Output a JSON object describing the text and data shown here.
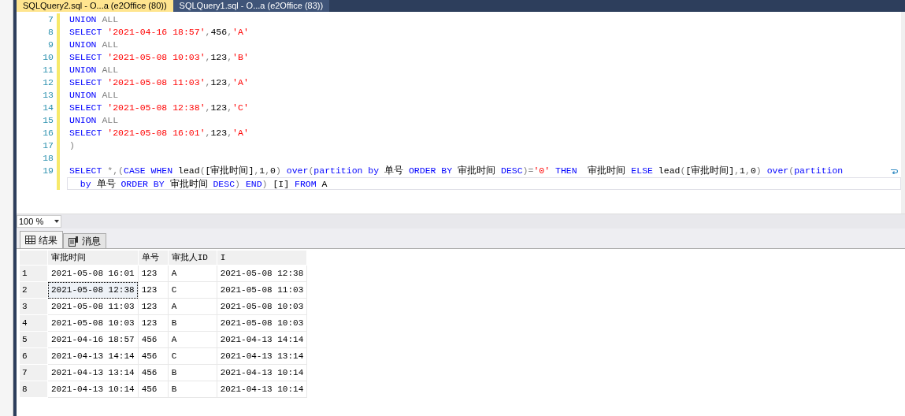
{
  "document_tabs": [
    {
      "title": "SQLQuery2.sql - O...a (e2Office (80))",
      "selected": true
    },
    {
      "title": "SQLQuery1.sql - O...a (e2Office (83))",
      "selected": false
    }
  ],
  "editor": {
    "lines": [
      {
        "number": "7",
        "tokens": [
          {
            "kind": "keyword",
            "text": "UNION"
          },
          {
            "kind": "operator",
            "text": " ALL"
          }
        ]
      },
      {
        "number": "8",
        "tokens": [
          {
            "kind": "keyword",
            "text": "SELECT "
          },
          {
            "kind": "string",
            "text": "'2021-04-16 18:57'"
          },
          {
            "kind": "operator",
            "text": ","
          },
          {
            "kind": "plain",
            "text": "456"
          },
          {
            "kind": "operator",
            "text": ","
          },
          {
            "kind": "string",
            "text": "'A'"
          }
        ]
      },
      {
        "number": "9",
        "tokens": [
          {
            "kind": "keyword",
            "text": "UNION"
          },
          {
            "kind": "operator",
            "text": " ALL"
          }
        ]
      },
      {
        "number": "10",
        "tokens": [
          {
            "kind": "keyword",
            "text": "SELECT "
          },
          {
            "kind": "string",
            "text": "'2021-05-08 10:03'"
          },
          {
            "kind": "operator",
            "text": ","
          },
          {
            "kind": "plain",
            "text": "123"
          },
          {
            "kind": "operator",
            "text": ","
          },
          {
            "kind": "string",
            "text": "'B'"
          }
        ]
      },
      {
        "number": "11",
        "tokens": [
          {
            "kind": "keyword",
            "text": "UNION"
          },
          {
            "kind": "operator",
            "text": " ALL"
          }
        ]
      },
      {
        "number": "12",
        "tokens": [
          {
            "kind": "keyword",
            "text": "SELECT "
          },
          {
            "kind": "string",
            "text": "'2021-05-08 11:03'"
          },
          {
            "kind": "operator",
            "text": ","
          },
          {
            "kind": "plain",
            "text": "123"
          },
          {
            "kind": "operator",
            "text": ","
          },
          {
            "kind": "string",
            "text": "'A'"
          }
        ]
      },
      {
        "number": "13",
        "tokens": [
          {
            "kind": "keyword",
            "text": "UNION"
          },
          {
            "kind": "operator",
            "text": " ALL"
          }
        ]
      },
      {
        "number": "14",
        "tokens": [
          {
            "kind": "keyword",
            "text": "SELECT "
          },
          {
            "kind": "string",
            "text": "'2021-05-08 12:38'"
          },
          {
            "kind": "operator",
            "text": ","
          },
          {
            "kind": "plain",
            "text": "123"
          },
          {
            "kind": "operator",
            "text": ","
          },
          {
            "kind": "string",
            "text": "'C'"
          }
        ]
      },
      {
        "number": "15",
        "tokens": [
          {
            "kind": "keyword",
            "text": "UNION"
          },
          {
            "kind": "operator",
            "text": " ALL"
          }
        ]
      },
      {
        "number": "16",
        "tokens": [
          {
            "kind": "keyword",
            "text": "SELECT "
          },
          {
            "kind": "string",
            "text": "'2021-05-08 16:01'"
          },
          {
            "kind": "operator",
            "text": ","
          },
          {
            "kind": "plain",
            "text": "123"
          },
          {
            "kind": "operator",
            "text": ","
          },
          {
            "kind": "string",
            "text": "'A'"
          }
        ]
      },
      {
        "number": "17",
        "tokens": [
          {
            "kind": "operator",
            "text": ")"
          }
        ]
      },
      {
        "number": "18"
      },
      {
        "number": "19",
        "tokens": [
          {
            "kind": "keyword",
            "text": "SELECT "
          },
          {
            "kind": "operator",
            "text": "*,("
          },
          {
            "kind": "keyword",
            "text": "CASE WHEN "
          },
          {
            "kind": "plain",
            "text": "lead"
          },
          {
            "kind": "operator",
            "text": "("
          },
          {
            "kind": "plain",
            "text": "[审批时间]"
          },
          {
            "kind": "operator",
            "text": ","
          },
          {
            "kind": "plain",
            "text": "1"
          },
          {
            "kind": "operator",
            "text": ","
          },
          {
            "kind": "plain",
            "text": "0"
          },
          {
            "kind": "operator",
            "text": ") "
          },
          {
            "kind": "keyword",
            "text": "over"
          },
          {
            "kind": "operator",
            "text": "("
          },
          {
            "kind": "keyword",
            "text": "partition by "
          },
          {
            "kind": "plain",
            "text": "单号 "
          },
          {
            "kind": "keyword",
            "text": "ORDER BY "
          },
          {
            "kind": "plain",
            "text": "审批时间 "
          },
          {
            "kind": "keyword",
            "text": "DESC"
          },
          {
            "kind": "operator",
            "text": ")="
          },
          {
            "kind": "string",
            "text": "'0'"
          },
          {
            "kind": "keyword",
            "text": " THEN  "
          },
          {
            "kind": "plain",
            "text": "审批时间 "
          },
          {
            "kind": "keyword",
            "text": "ELSE "
          },
          {
            "kind": "plain",
            "text": "lead"
          },
          {
            "kind": "operator",
            "text": "("
          },
          {
            "kind": "plain",
            "text": "[审批时间]"
          },
          {
            "kind": "operator",
            "text": ","
          },
          {
            "kind": "plain",
            "text": "1"
          },
          {
            "kind": "operator",
            "text": ","
          },
          {
            "kind": "plain",
            "text": "0"
          },
          {
            "kind": "operator",
            "text": ") "
          },
          {
            "kind": "keyword",
            "text": "over"
          },
          {
            "kind": "operator",
            "text": "("
          },
          {
            "kind": "keyword",
            "text": "partition"
          }
        ],
        "continuation": [
          {
            "kind": "keyword",
            "text": "  by "
          },
          {
            "kind": "plain",
            "text": "单号 "
          },
          {
            "kind": "keyword",
            "text": "ORDER BY "
          },
          {
            "kind": "plain",
            "text": "审批时间 "
          },
          {
            "kind": "keyword",
            "text": "DESC"
          },
          {
            "kind": "operator",
            "text": ") "
          },
          {
            "kind": "keyword",
            "text": "END"
          },
          {
            "kind": "operator",
            "text": ") "
          },
          {
            "kind": "plain",
            "text": "[I] "
          },
          {
            "kind": "keyword",
            "text": "FROM "
          },
          {
            "kind": "plain",
            "text": "A"
          }
        ]
      }
    ]
  },
  "zoom": {
    "value": "100 %"
  },
  "result_tabs": [
    {
      "label": "结果",
      "kind": "grid",
      "selected": true
    },
    {
      "label": "消息",
      "kind": "messages",
      "selected": false
    }
  ],
  "results": {
    "columns": [
      "审批时间",
      "单号",
      "审批人ID",
      "I"
    ],
    "rows": [
      {
        "number": "1",
        "cells": [
          "2021-05-08 16:01",
          "123",
          "A",
          "2021-05-08 12:38"
        ],
        "focused": false
      },
      {
        "number": "2",
        "cells": [
          "2021-05-08 12:38",
          "123",
          "C",
          "2021-05-08 11:03"
        ],
        "focused": true
      },
      {
        "number": "3",
        "cells": [
          "2021-05-08 11:03",
          "123",
          "A",
          "2021-05-08 10:03"
        ],
        "focused": false
      },
      {
        "number": "4",
        "cells": [
          "2021-05-08 10:03",
          "123",
          "B",
          "2021-05-08 10:03"
        ],
        "focused": false
      },
      {
        "number": "5",
        "cells": [
          "2021-04-16 18:57",
          "456",
          "A",
          "2021-04-13 14:14"
        ],
        "focused": false
      },
      {
        "number": "6",
        "cells": [
          "2021-04-13 14:14",
          "456",
          "C",
          "2021-04-13 13:14"
        ],
        "focused": false
      },
      {
        "number": "7",
        "cells": [
          "2021-04-13 13:14",
          "456",
          "B",
          "2021-04-13 10:14"
        ],
        "focused": false
      },
      {
        "number": "8",
        "cells": [
          "2021-04-13 10:14",
          "456",
          "B",
          "2021-04-13 10:14"
        ],
        "focused": false
      }
    ]
  }
}
